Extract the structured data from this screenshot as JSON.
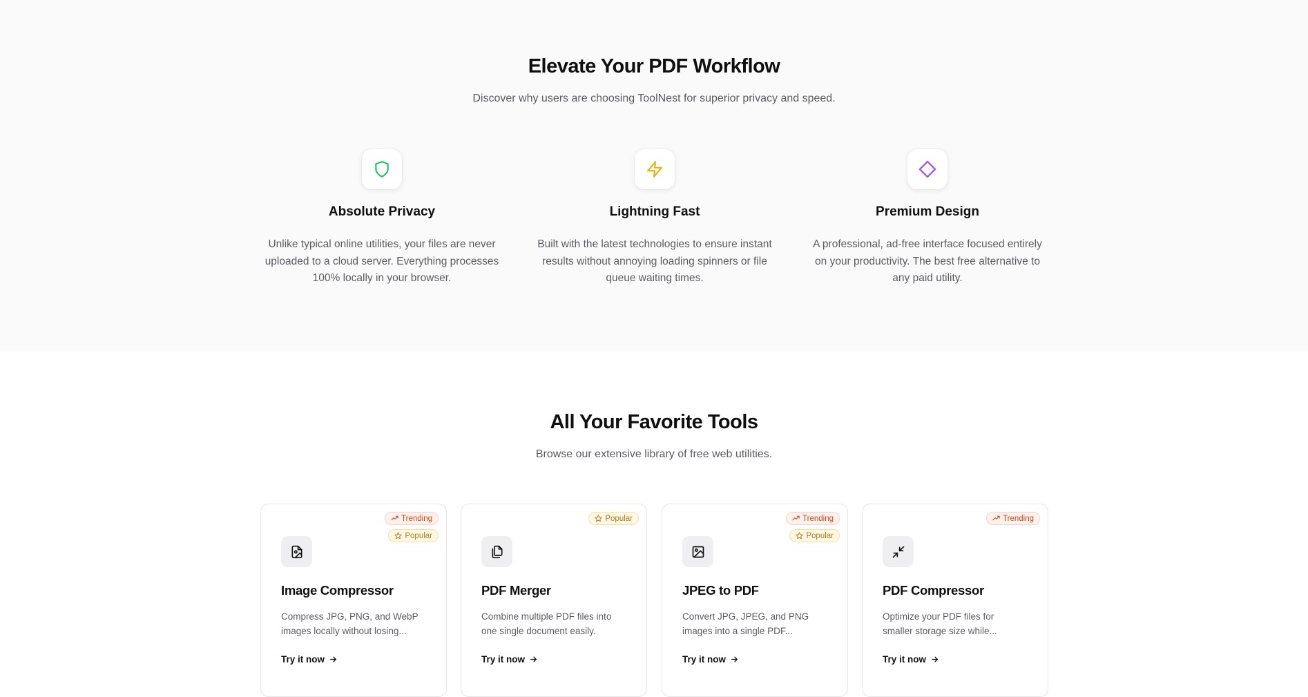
{
  "features": {
    "title": "Elevate Your PDF Workflow",
    "subtitle": "Discover why users are choosing ToolNest for superior privacy and speed.",
    "items": [
      {
        "icon": "shield-icon",
        "color": "#22c55e",
        "title": "Absolute Privacy",
        "text": "Unlike typical online utilities, your files are never uploaded to a cloud server. Everything processes 100% locally in your browser."
      },
      {
        "icon": "lightning-icon",
        "color": "#eab308",
        "title": "Lightning Fast",
        "text": "Built with the latest technologies to ensure instant results without annoying loading spinners or file queue waiting times."
      },
      {
        "icon": "diamond-icon",
        "color": "#a855f7",
        "title": "Premium Design",
        "text": "A professional, ad-free interface focused entirely on your productivity. The best free alternative to any paid utility."
      }
    ]
  },
  "tools": {
    "title": "All Your Favorite Tools",
    "subtitle": "Browse our extensive library of free web utilities.",
    "cards": [
      {
        "icon": "image-file-icon",
        "title": "Image Compressor",
        "desc": "Compress JPG, PNG, and WebP images locally without losing...",
        "link": "Try it now",
        "badges": [
          "Trending",
          "Popular"
        ]
      },
      {
        "icon": "copy-files-icon",
        "title": "PDF Merger",
        "desc": "Combine multiple PDF files into one single document easily.",
        "link": "Try it now",
        "badges": [
          "Popular"
        ]
      },
      {
        "icon": "image-icon",
        "title": "JPEG to PDF",
        "desc": "Convert JPG, JPEG, and PNG images into a single PDF...",
        "link": "Try it now",
        "badges": [
          "Trending",
          "Popular"
        ]
      },
      {
        "icon": "minimize-arrows-icon",
        "title": "PDF Compressor",
        "desc": "Optimize your PDF files for smaller storage size while...",
        "link": "Try it now",
        "badges": [
          "Trending"
        ]
      }
    ]
  },
  "colors": {
    "trending": "#d9461c",
    "popular": "#b7791f"
  }
}
